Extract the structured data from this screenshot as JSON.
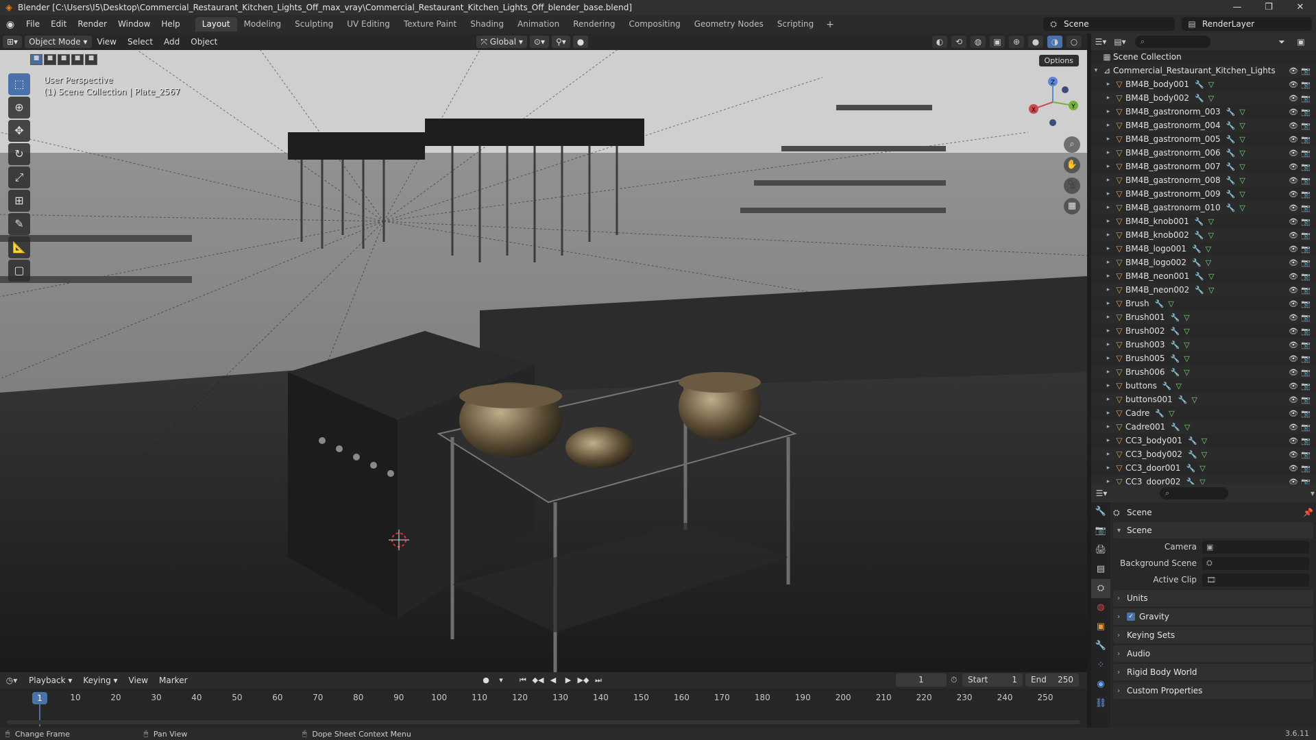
{
  "window": {
    "title": "Blender [C:\\Users\\I5\\Desktop\\Commercial_Restaurant_Kitchen_Lights_Off_max_vray\\Commercial_Restaurant_Kitchen_Lights_Off_blender_base.blend]",
    "controls": [
      "—",
      "❐",
      "✕"
    ]
  },
  "menubar": {
    "items": [
      "File",
      "Edit",
      "Render",
      "Window",
      "Help"
    ],
    "workspaces": [
      "Layout",
      "Modeling",
      "Sculpting",
      "UV Editing",
      "Texture Paint",
      "Shading",
      "Animation",
      "Rendering",
      "Compositing",
      "Geometry Nodes",
      "Scripting"
    ],
    "active_workspace": "Layout",
    "add_tab": "+",
    "scene": "Scene",
    "view_layer": "RenderLayer"
  },
  "viewport": {
    "mode": "Object Mode",
    "menus": [
      "View",
      "Select",
      "Add",
      "Object"
    ],
    "transform": "Global",
    "options": "Options",
    "info_line1": "User Perspective",
    "info_line2": "(1) Scene Collection | Plate_2567",
    "gizmo": {
      "x": "X",
      "y": "Y",
      "z": "Z"
    }
  },
  "outliner": {
    "search_placeholder": "",
    "root": "Scene Collection",
    "collection": "Commercial_Restaurant_Kitchen_Lights",
    "items": [
      "BM4B_body001",
      "BM4B_body002",
      "BM4B_gastronorm_003",
      "BM4B_gastronorm_004",
      "BM4B_gastronorm_005",
      "BM4B_gastronorm_006",
      "BM4B_gastronorm_007",
      "BM4B_gastronorm_008",
      "BM4B_gastronorm_009",
      "BM4B_gastronorm_010",
      "BM4B_knob001",
      "BM4B_knob002",
      "BM4B_logo001",
      "BM4B_logo002",
      "BM4B_neon001",
      "BM4B_neon002",
      "Brush",
      "Brush001",
      "Brush002",
      "Brush003",
      "Brush005",
      "Brush006",
      "buttons",
      "buttons001",
      "Cadre",
      "Cadre001",
      "CC3_body001",
      "CC3_body002",
      "CC3_door001",
      "CC3_door002"
    ]
  },
  "properties": {
    "crumb": "Scene",
    "panel": "Scene",
    "fields": [
      {
        "label": "Camera",
        "value": ""
      },
      {
        "label": "Background Scene",
        "value": ""
      },
      {
        "label": "Active Clip",
        "value": ""
      }
    ],
    "sections": [
      "Units",
      "Gravity",
      "Keying Sets",
      "Audio",
      "Rigid Body World",
      "Custom Properties"
    ],
    "gravity_checked": true
  },
  "timeline": {
    "menus": [
      "Playback",
      "Keying",
      "View",
      "Marker"
    ],
    "current_frame": "1",
    "start_label": "Start",
    "start": "1",
    "end_label": "End",
    "end": "250",
    "ticks": [
      "1",
      "10",
      "20",
      "30",
      "40",
      "50",
      "60",
      "70",
      "80",
      "90",
      "100",
      "110",
      "120",
      "130",
      "140",
      "150",
      "160",
      "170",
      "180",
      "190",
      "200",
      "210",
      "220",
      "230",
      "240",
      "250"
    ]
  },
  "statusbar": {
    "items": [
      "Change Frame",
      "Pan View",
      "Dope Sheet Context Menu"
    ],
    "version": "3.6.11"
  },
  "colors": {
    "accent": "#4a72aa",
    "object_icon": "#e89b3a",
    "modifier_icon": "#6fa8ff",
    "mesh_icon": "#7ed67e"
  }
}
